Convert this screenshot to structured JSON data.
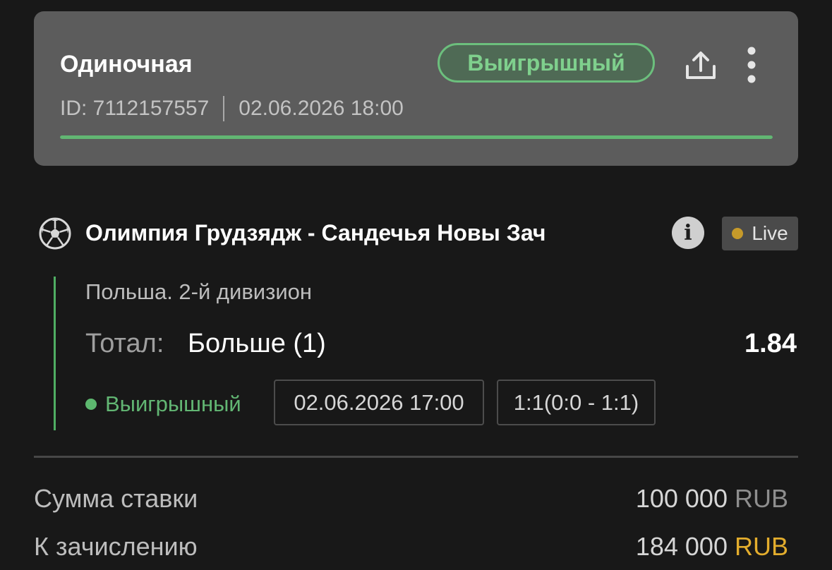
{
  "header": {
    "bet_type": "Одиночная",
    "status": "Выигрышный",
    "id_text": "ID: 7112157557",
    "datetime": "02.06.2026 18:00",
    "progress": 1.0
  },
  "event": {
    "icon": "soccer-ball-icon",
    "title": "Олимпия Грудзядж - Сандечья Новы Зач",
    "info_icon": "i",
    "live_label": "Live"
  },
  "selection": {
    "league": "Польша. 2-й дивизион",
    "market_label": "Тотал:",
    "pick": "Больше (1)",
    "odds": "1.84",
    "result": "Выигрышный",
    "event_datetime": "02.06.2026 17:00",
    "score": "1:1(0:0 - 1:1)"
  },
  "totals": {
    "stake_label": "Сумма ставки",
    "stake_amount": "100 000",
    "stake_currency": "RUB",
    "payout_label": "К зачислению",
    "payout_amount": "184 000",
    "payout_currency": "RUB"
  },
  "colors": {
    "win_green": "#62b673",
    "currency_gold": "#e3ad2d",
    "live_dot": "#c69a2a"
  }
}
